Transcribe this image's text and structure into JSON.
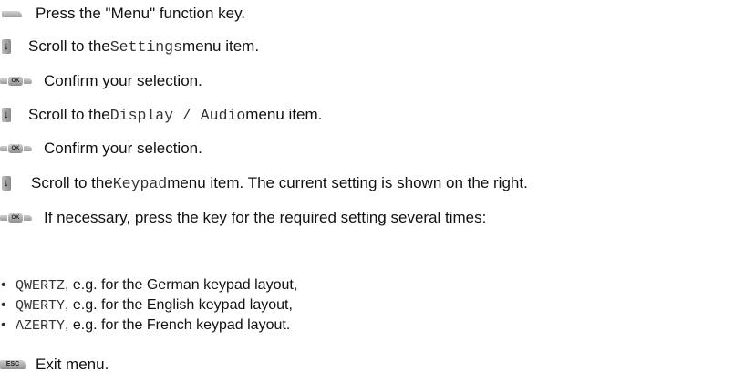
{
  "steps": [
    {
      "icon": "menu-key-icon",
      "text": "Press the \"Menu\" function key."
    },
    {
      "icon": "scroll-down-icon",
      "pre": "Scroll to the ",
      "code": "Settings",
      "post": " menu item."
    },
    {
      "icon": "ok-key-icon",
      "icon_label": "OK",
      "text": "Confirm your selection."
    },
    {
      "icon": "scroll-down-icon",
      "pre": "Scroll to the ",
      "code": "Display / Audio",
      "post": " menu item."
    },
    {
      "icon": "ok-key-icon",
      "icon_label": "OK",
      "text": "Confirm your selection."
    },
    {
      "icon": "scroll-down-icon",
      "pre": "Scroll to the ",
      "code": "Keypad",
      "post": " menu item. The current setting is shown on the right."
    },
    {
      "icon": "ok-key-icon",
      "icon_label": "OK",
      "text": "If necessary, press the key for the required setting several times:"
    }
  ],
  "bullets": [
    {
      "code": "QWERTZ",
      "text": ", e.g. for the German keypad layout,"
    },
    {
      "code": "QWERTY",
      "text": ", e.g. for the English keypad layout,"
    },
    {
      "code": "AZERTY",
      "text": ", e.g. for the French keypad layout."
    }
  ],
  "bullet_marker": "•",
  "exit": {
    "icon": "esc-key-icon",
    "icon_label": "ESC",
    "text": "Exit menu."
  }
}
